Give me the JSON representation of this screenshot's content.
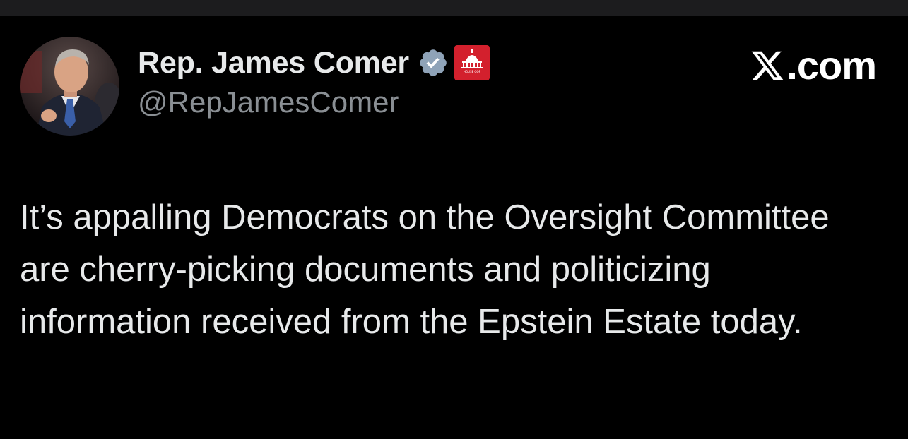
{
  "tweet": {
    "author": {
      "display_name": "Rep. James Comer",
      "handle": "@RepJamesComer",
      "verified_icon": "verified-badge-icon",
      "affiliation_icon": "house-gop-capitol-icon",
      "affiliation_badge_text": "HOUSE GOP",
      "affiliation_color": "#d3202d",
      "verified_color": "#8fa3b8"
    },
    "brand": {
      "icon": "x-logo-icon",
      "text": ".com"
    },
    "text": "It’s appalling Democrats on the Oversight Committee are cherry-picking documents and politicizing information received from the Epstein Estate today."
  },
  "colors": {
    "background": "#000000",
    "top_bar": "#1c1c1e",
    "primary_text": "#e7e9ea",
    "secondary_text": "#8a8f94"
  }
}
